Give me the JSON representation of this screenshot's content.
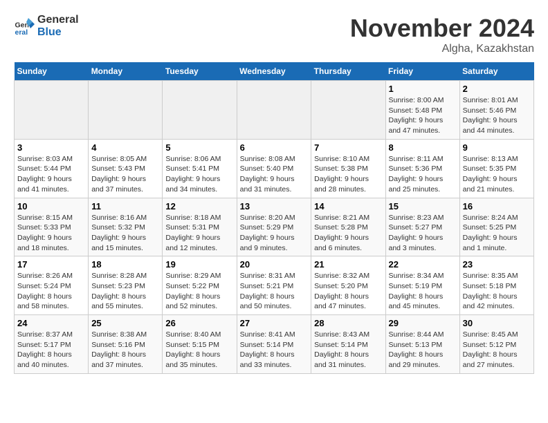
{
  "logo": {
    "line1": "General",
    "line2": "Blue"
  },
  "title": "November 2024",
  "location": "Algha, Kazakhstan",
  "days_of_week": [
    "Sunday",
    "Monday",
    "Tuesday",
    "Wednesday",
    "Thursday",
    "Friday",
    "Saturday"
  ],
  "weeks": [
    [
      {
        "day": "",
        "info": ""
      },
      {
        "day": "",
        "info": ""
      },
      {
        "day": "",
        "info": ""
      },
      {
        "day": "",
        "info": ""
      },
      {
        "day": "",
        "info": ""
      },
      {
        "day": "1",
        "info": "Sunrise: 8:00 AM\nSunset: 5:48 PM\nDaylight: 9 hours and 47 minutes."
      },
      {
        "day": "2",
        "info": "Sunrise: 8:01 AM\nSunset: 5:46 PM\nDaylight: 9 hours and 44 minutes."
      }
    ],
    [
      {
        "day": "3",
        "info": "Sunrise: 8:03 AM\nSunset: 5:44 PM\nDaylight: 9 hours and 41 minutes."
      },
      {
        "day": "4",
        "info": "Sunrise: 8:05 AM\nSunset: 5:43 PM\nDaylight: 9 hours and 37 minutes."
      },
      {
        "day": "5",
        "info": "Sunrise: 8:06 AM\nSunset: 5:41 PM\nDaylight: 9 hours and 34 minutes."
      },
      {
        "day": "6",
        "info": "Sunrise: 8:08 AM\nSunset: 5:40 PM\nDaylight: 9 hours and 31 minutes."
      },
      {
        "day": "7",
        "info": "Sunrise: 8:10 AM\nSunset: 5:38 PM\nDaylight: 9 hours and 28 minutes."
      },
      {
        "day": "8",
        "info": "Sunrise: 8:11 AM\nSunset: 5:36 PM\nDaylight: 9 hours and 25 minutes."
      },
      {
        "day": "9",
        "info": "Sunrise: 8:13 AM\nSunset: 5:35 PM\nDaylight: 9 hours and 21 minutes."
      }
    ],
    [
      {
        "day": "10",
        "info": "Sunrise: 8:15 AM\nSunset: 5:33 PM\nDaylight: 9 hours and 18 minutes."
      },
      {
        "day": "11",
        "info": "Sunrise: 8:16 AM\nSunset: 5:32 PM\nDaylight: 9 hours and 15 minutes."
      },
      {
        "day": "12",
        "info": "Sunrise: 8:18 AM\nSunset: 5:31 PM\nDaylight: 9 hours and 12 minutes."
      },
      {
        "day": "13",
        "info": "Sunrise: 8:20 AM\nSunset: 5:29 PM\nDaylight: 9 hours and 9 minutes."
      },
      {
        "day": "14",
        "info": "Sunrise: 8:21 AM\nSunset: 5:28 PM\nDaylight: 9 hours and 6 minutes."
      },
      {
        "day": "15",
        "info": "Sunrise: 8:23 AM\nSunset: 5:27 PM\nDaylight: 9 hours and 3 minutes."
      },
      {
        "day": "16",
        "info": "Sunrise: 8:24 AM\nSunset: 5:25 PM\nDaylight: 9 hours and 1 minute."
      }
    ],
    [
      {
        "day": "17",
        "info": "Sunrise: 8:26 AM\nSunset: 5:24 PM\nDaylight: 8 hours and 58 minutes."
      },
      {
        "day": "18",
        "info": "Sunrise: 8:28 AM\nSunset: 5:23 PM\nDaylight: 8 hours and 55 minutes."
      },
      {
        "day": "19",
        "info": "Sunrise: 8:29 AM\nSunset: 5:22 PM\nDaylight: 8 hours and 52 minutes."
      },
      {
        "day": "20",
        "info": "Sunrise: 8:31 AM\nSunset: 5:21 PM\nDaylight: 8 hours and 50 minutes."
      },
      {
        "day": "21",
        "info": "Sunrise: 8:32 AM\nSunset: 5:20 PM\nDaylight: 8 hours and 47 minutes."
      },
      {
        "day": "22",
        "info": "Sunrise: 8:34 AM\nSunset: 5:19 PM\nDaylight: 8 hours and 45 minutes."
      },
      {
        "day": "23",
        "info": "Sunrise: 8:35 AM\nSunset: 5:18 PM\nDaylight: 8 hours and 42 minutes."
      }
    ],
    [
      {
        "day": "24",
        "info": "Sunrise: 8:37 AM\nSunset: 5:17 PM\nDaylight: 8 hours and 40 minutes."
      },
      {
        "day": "25",
        "info": "Sunrise: 8:38 AM\nSunset: 5:16 PM\nDaylight: 8 hours and 37 minutes."
      },
      {
        "day": "26",
        "info": "Sunrise: 8:40 AM\nSunset: 5:15 PM\nDaylight: 8 hours and 35 minutes."
      },
      {
        "day": "27",
        "info": "Sunrise: 8:41 AM\nSunset: 5:14 PM\nDaylight: 8 hours and 33 minutes."
      },
      {
        "day": "28",
        "info": "Sunrise: 8:43 AM\nSunset: 5:14 PM\nDaylight: 8 hours and 31 minutes."
      },
      {
        "day": "29",
        "info": "Sunrise: 8:44 AM\nSunset: 5:13 PM\nDaylight: 8 hours and 29 minutes."
      },
      {
        "day": "30",
        "info": "Sunrise: 8:45 AM\nSunset: 5:12 PM\nDaylight: 8 hours and 27 minutes."
      }
    ]
  ]
}
